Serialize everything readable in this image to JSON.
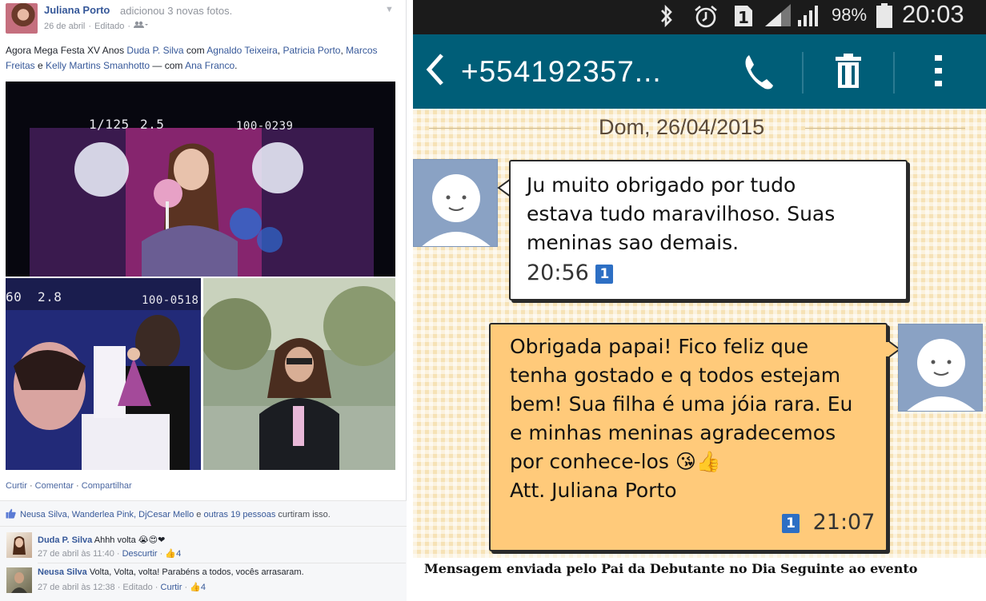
{
  "facebook": {
    "author": "Juliana Porto",
    "action": "adicionou 3 novas fotos.",
    "date": "26 de abril",
    "edited": "Editado",
    "text_prefix": "Agora Mega Festa XV Anos ",
    "tag1": "Duda P. Silva",
    "text_com": " com ",
    "tag2": "Agnaldo Teixeira",
    "comma1": ", ",
    "tag3": "Patricia Porto",
    "comma2": ", ",
    "tag4": "Marcos Freitas",
    "text_e": " e ",
    "tag5": "Kelly Martins Smanhotto",
    "text_with": " — com ",
    "tag6": "Ana Franco",
    "text_end": ".",
    "photo1_overlay": {
      "shutter": "1/125",
      "aperture": "2.5",
      "frame": "100-0239"
    },
    "photo2_overlay": {
      "shutter": "60",
      "aperture": "2.8",
      "frame": "100-0518"
    },
    "actions": {
      "curtir": "Curtir",
      "comentar": "Comentar",
      "compartilhar": "Compartilhar",
      "sep": " · "
    },
    "likes": {
      "names": "Neusa Silva, Wanderlea Pink, DjCesar Mello",
      "e": " e ",
      "others": "outras 19 pessoas",
      "tail": " curtiram isso."
    },
    "comments": [
      {
        "author": "Duda P. Silva",
        "text": "Ahhh volta 😭😍❤",
        "date": "27 de abril às 11:40",
        "sep": " · ",
        "reply": "Descurtir",
        "likes": "4"
      },
      {
        "author": "Neusa Silva",
        "text": "Volta, Volta, volta! Parabéns a todos, vocês arrasaram.",
        "date": "27 de abril às 12:38",
        "edited": "Editado",
        "reply": "Curtir",
        "likes": "4"
      }
    ]
  },
  "sms": {
    "status": {
      "battery": "98%",
      "time": "20:03",
      "sim": "1"
    },
    "contact_number": "+554192357...",
    "date": "Dom, 26/04/2015",
    "incoming": {
      "text": "Ju muito obrigado por tudo\nestava tudo maravilhoso.  Suas\nmeninas sao demais.",
      "time": "20:56"
    },
    "outgoing": {
      "text": "Obrigada papai! Fico feliz que\ntenha gostado e q todos estejam\nbem! Sua filha é uma jóia rara. Eu\ne minhas meninas agradecemos\npor conhece-los 😘👍\nAtt.  Juliana Porto",
      "time": "21:07"
    },
    "sim_badge": "1"
  },
  "caption": "Mensagem enviada pelo Pai da Debutante no Dia Seguinte ao evento",
  "colors": {
    "fb_link": "#365899",
    "app_bar": "#005e78",
    "bubble_out": "#ffca7a",
    "thread_bg": "#f6e2b6"
  }
}
